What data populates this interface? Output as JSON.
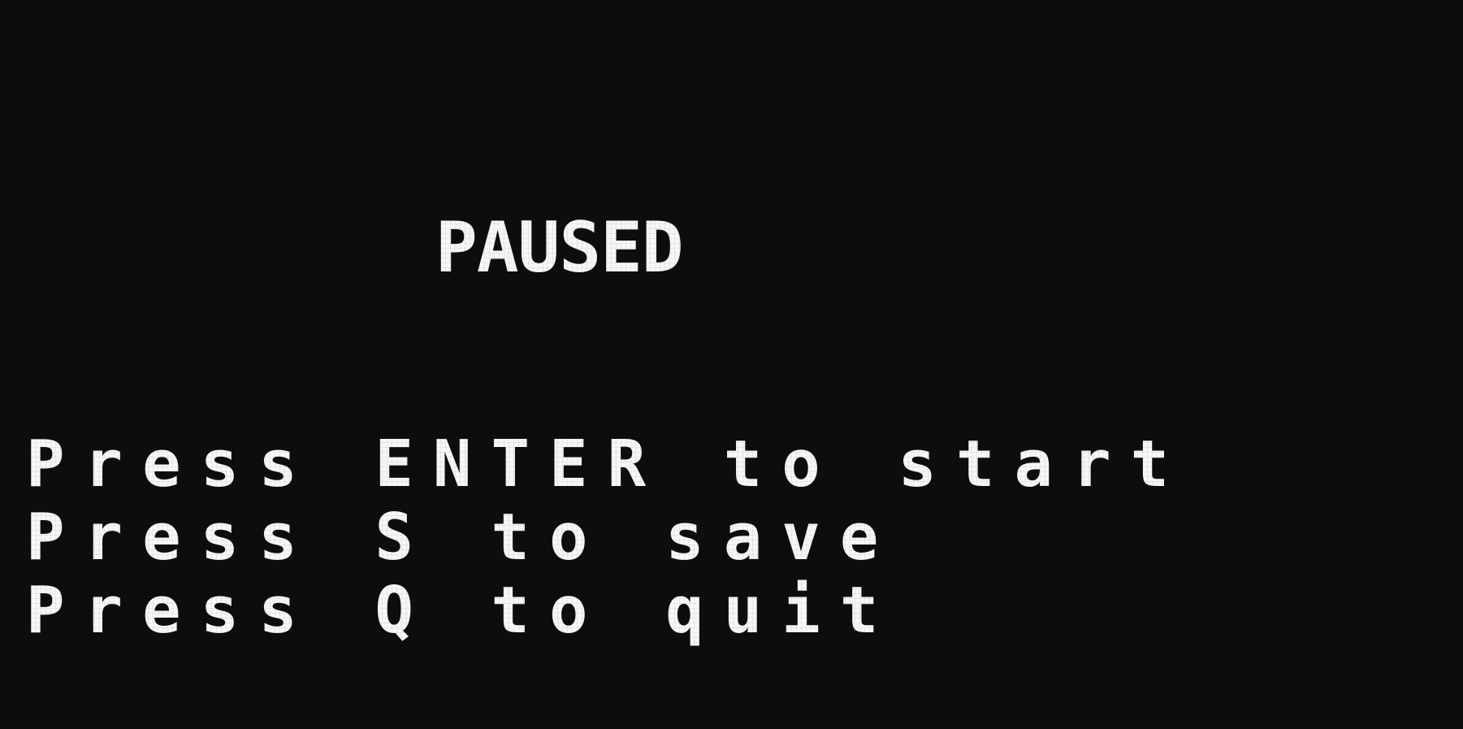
{
  "pause_screen": {
    "title": "PAUSED",
    "options": [
      {
        "label": "Press ENTER to start"
      },
      {
        "label": "Press S to save"
      },
      {
        "label": "Press Q to quit"
      }
    ]
  },
  "colors": {
    "background": "#0d0d0d",
    "text": "#f7f7f7"
  }
}
